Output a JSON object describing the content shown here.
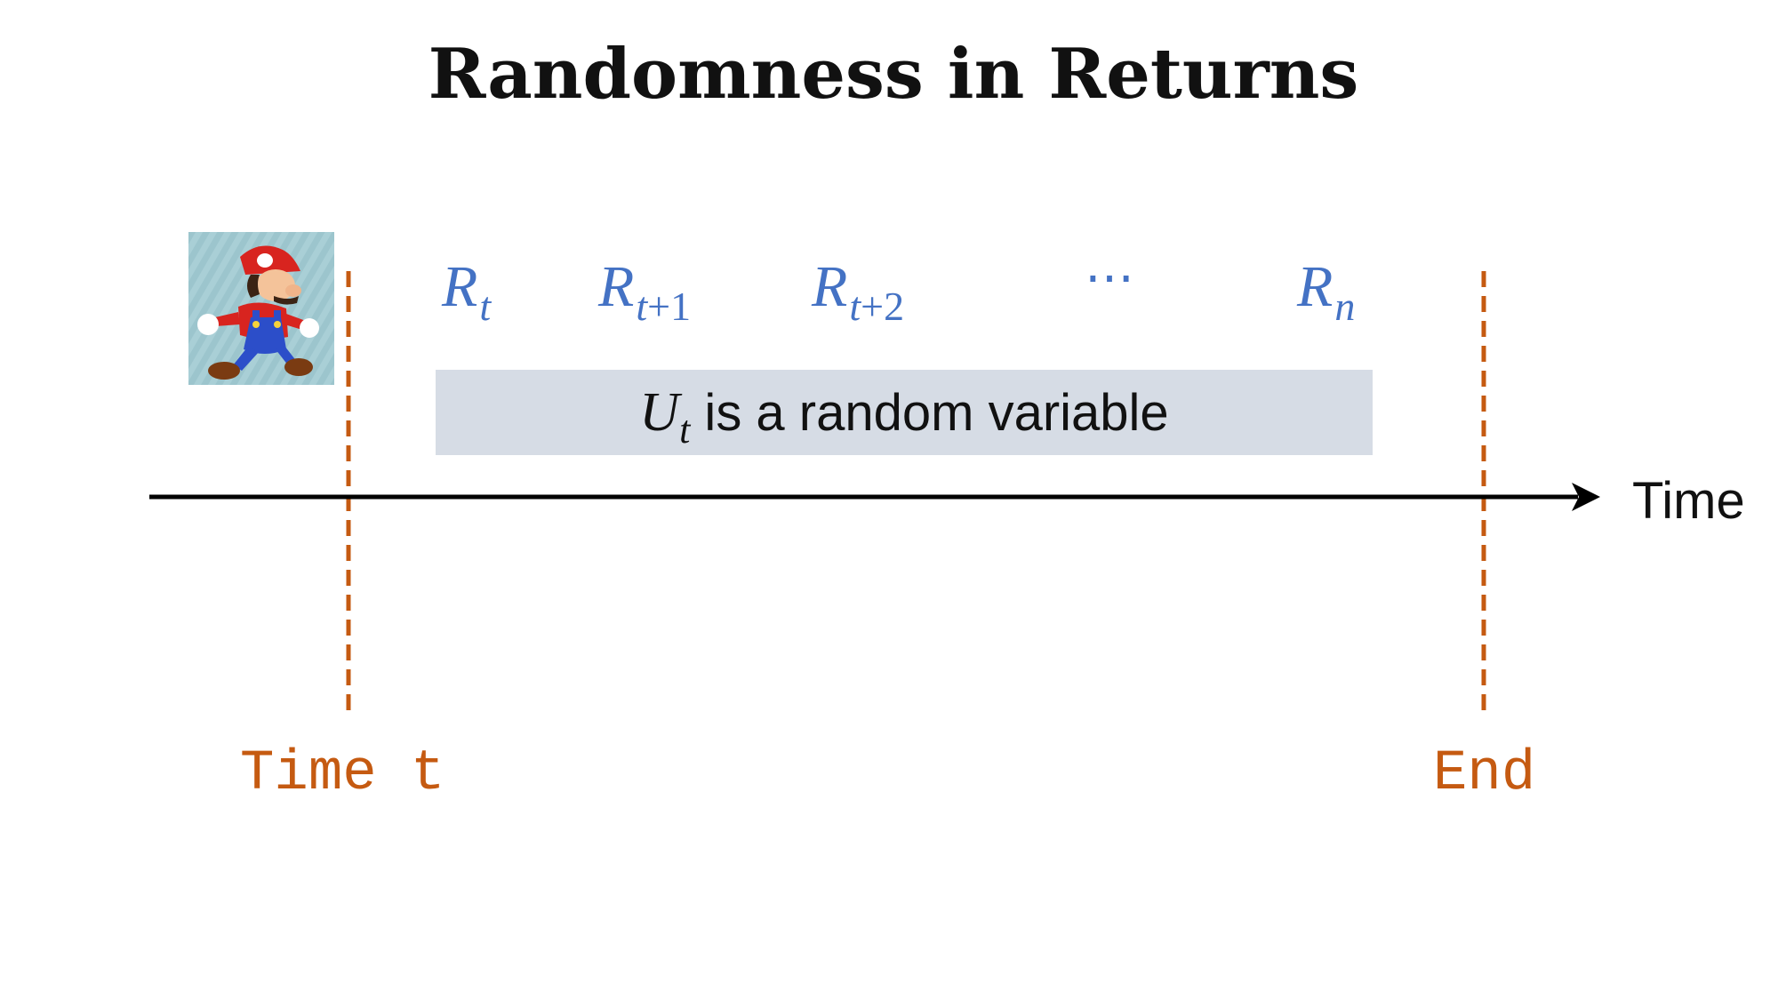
{
  "title": "Randomness in Returns",
  "rewards": [
    {
      "symbol": "R",
      "subscript": "t",
      "sub_op": "",
      "sub_num": ""
    },
    {
      "symbol": "R",
      "subscript": "t",
      "sub_op": "+",
      "sub_num": "1"
    },
    {
      "symbol": "R",
      "subscript": "t",
      "sub_op": "+",
      "sub_num": "2"
    },
    {
      "symbol": "R",
      "subscript": "n",
      "sub_op": "",
      "sub_num": ""
    }
  ],
  "ellipsis": "⋯",
  "banner": {
    "variable": "U",
    "variable_subscript": "t",
    "text": " is a random variable"
  },
  "axis": {
    "label": "Time"
  },
  "markers": {
    "start_label": "Time t",
    "end_label": "End"
  },
  "agent_icon": "mario-running-icon",
  "colors": {
    "reward_text": "#4472c4",
    "marker": "#c55a11",
    "banner_bg": "#d6dce5",
    "axis": "#000000"
  }
}
